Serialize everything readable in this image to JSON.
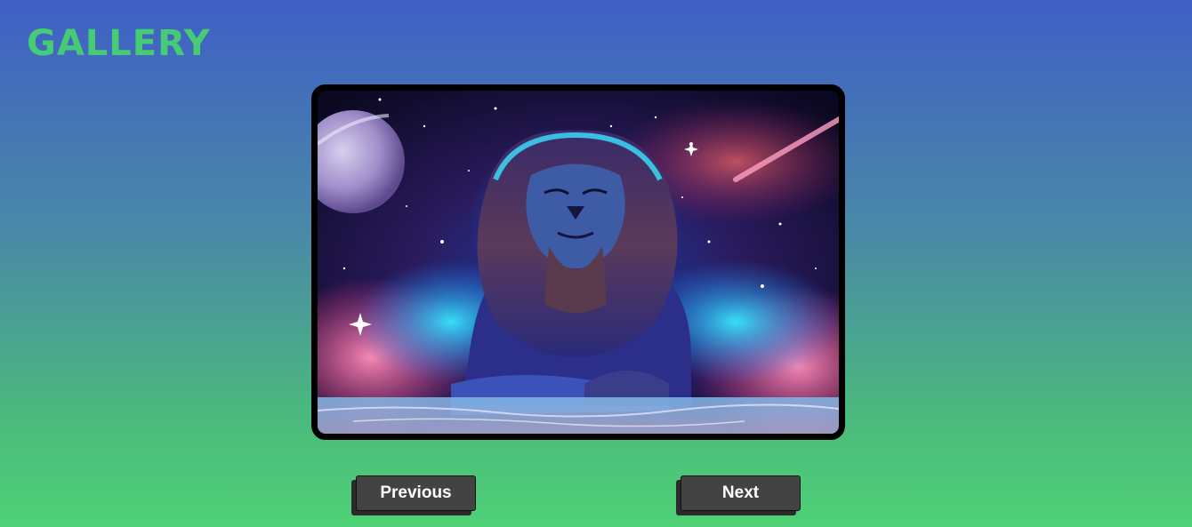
{
  "header": {
    "logo_text": "GALLERY"
  },
  "gallery": {
    "image_subject": "cosmic lion artwork"
  },
  "controls": {
    "previous_label": "Previous",
    "next_label": "Next"
  },
  "colors": {
    "logo": "#47cc76",
    "button_bg": "#434343",
    "frame_border": "#000000",
    "bg_top": "#3f5fc6",
    "bg_bottom": "#4fd176"
  }
}
